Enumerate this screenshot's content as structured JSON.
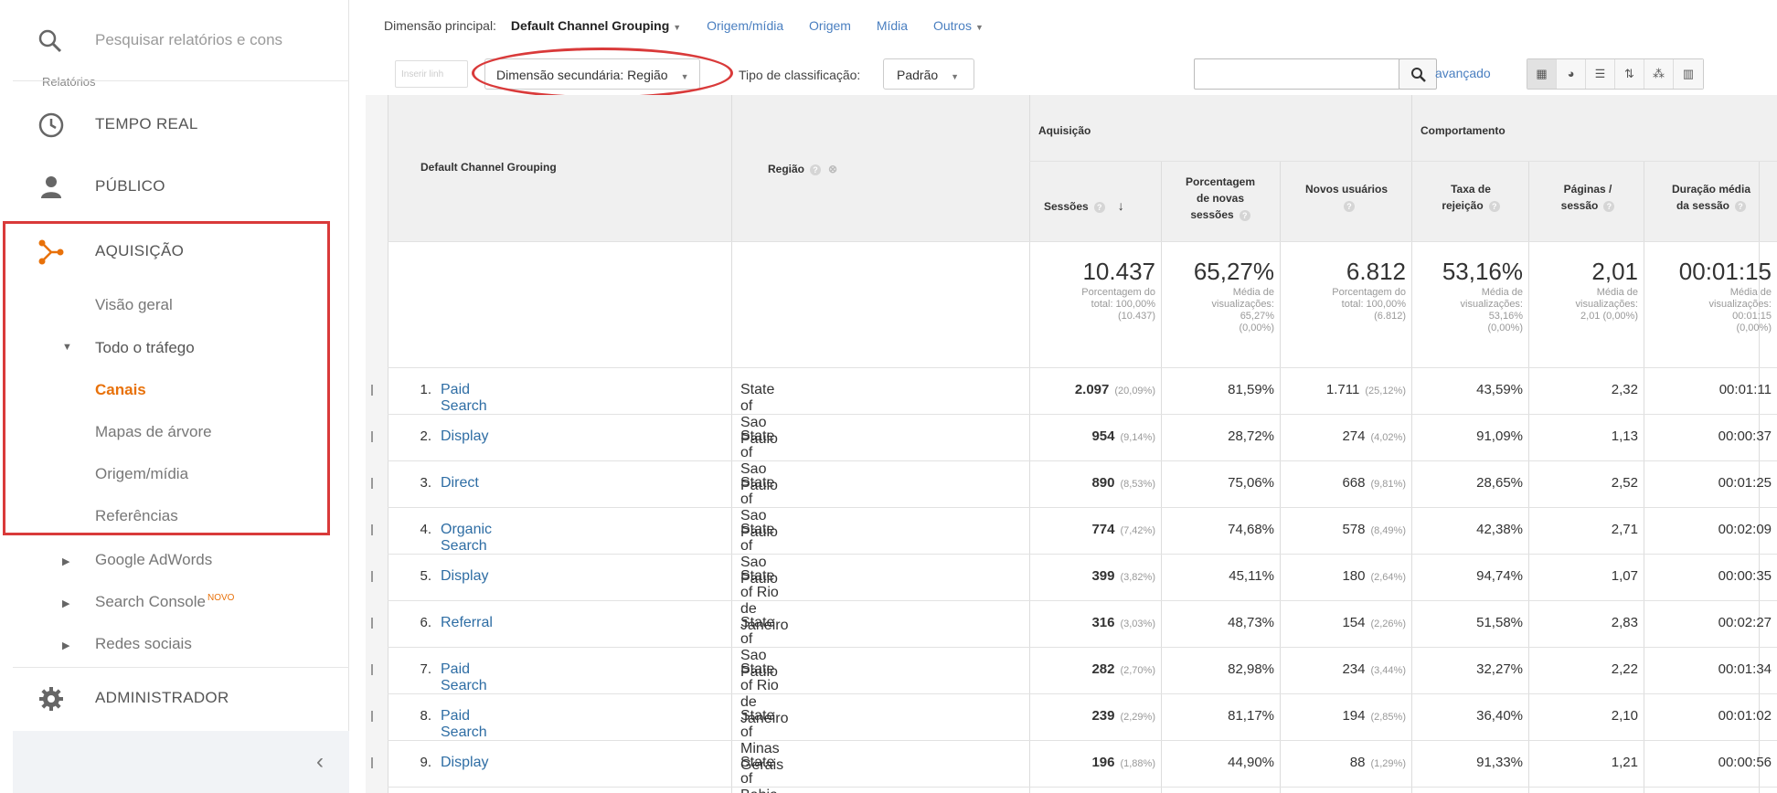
{
  "sidebar": {
    "search_placeholder": "Pesquisar relatórios e cons",
    "search_cut_label": "Relatórios",
    "realtime": "TEMPO REAL",
    "audience": "PÚBLICO",
    "acquisition": "AQUISIÇÃO",
    "acq_items": [
      "Visão geral",
      "Todo o tráfego",
      "Canais",
      "Mapas de árvore",
      "Origem/mídia",
      "Referências"
    ],
    "other_items": [
      "Google AdWords",
      "Search Console",
      "Redes sociais"
    ],
    "new_badge": "NOVO",
    "admin": "ADMINISTRADOR",
    "collapse_icon": "‹"
  },
  "toolbar": {
    "primary_dim_label": "Dimensão principal:",
    "primary_dim_value": "Default Channel Grouping",
    "links": [
      "Origem/mídia",
      "Origem",
      "Mídia",
      "Outros"
    ],
    "faded_button": "Inserir linh",
    "secondary_dim": "Dimensão secundária: Região",
    "sort_label": "Tipo de classificação:",
    "sort_value": "Padrão",
    "advanced": "avançado"
  },
  "table": {
    "col_channel": "Default Channel Grouping",
    "col_region": "Região",
    "group_acq": "Aquisição",
    "group_beh": "Comportamento",
    "col_sessions": "Sessões",
    "col_new_sessions": [
      "Porcentagem",
      "de novas",
      "sessões"
    ],
    "col_new_users": "Novos usuários",
    "col_bounce": [
      "Taxa de",
      "rejeição"
    ],
    "col_pages": [
      "Páginas /",
      "sessão"
    ],
    "col_duration": [
      "Duração média",
      "da sessão"
    ],
    "totals": {
      "sessions": "10.437",
      "sessions_sub": [
        "Porcentagem do",
        "total: 100,00%",
        "(10.437)"
      ],
      "new_sessions": "65,27%",
      "new_sessions_sub": [
        "Média de",
        "visualizações:",
        "65,27%",
        "(0,00%)"
      ],
      "new_users": "6.812",
      "new_users_sub": [
        "Porcentagem do",
        "total: 100,00%",
        "(6.812)"
      ],
      "bounce": "53,16%",
      "bounce_sub": [
        "Média de",
        "visualizações:",
        "53,16%",
        "(0,00%)"
      ],
      "pages": "2,01",
      "pages_sub": [
        "Média de",
        "visualizações:",
        "2,01 (0,00%)"
      ],
      "duration": "00:01:15",
      "duration_sub": [
        "Média de",
        "visualizações:",
        "00:01:15",
        "(0,00%)"
      ]
    },
    "rows": [
      {
        "n": "1.",
        "channel": "Paid Search",
        "region": "State of Sao Paulo",
        "sessions": "2.097",
        "sessions_pct": "(20,09%)",
        "new_sessions": "81,59%",
        "new_users": "1.711",
        "new_users_pct": "(25,12%)",
        "bounce": "43,59%",
        "pages": "2,32",
        "duration": "00:01:11"
      },
      {
        "n": "2.",
        "channel": "Display",
        "region": "State of Sao Paulo",
        "sessions": "954",
        "sessions_pct": "(9,14%)",
        "new_sessions": "28,72%",
        "new_users": "274",
        "new_users_pct": "(4,02%)",
        "bounce": "91,09%",
        "pages": "1,13",
        "duration": "00:00:37"
      },
      {
        "n": "3.",
        "channel": "Direct",
        "region": "State of Sao Paulo",
        "sessions": "890",
        "sessions_pct": "(8,53%)",
        "new_sessions": "75,06%",
        "new_users": "668",
        "new_users_pct": "(9,81%)",
        "bounce": "28,65%",
        "pages": "2,52",
        "duration": "00:01:25"
      },
      {
        "n": "4.",
        "channel": "Organic Search",
        "region": "State of Sao Paulo",
        "sessions": "774",
        "sessions_pct": "(7,42%)",
        "new_sessions": "74,68%",
        "new_users": "578",
        "new_users_pct": "(8,49%)",
        "bounce": "42,38%",
        "pages": "2,71",
        "duration": "00:02:09"
      },
      {
        "n": "5.",
        "channel": "Display",
        "region": "State of Rio de Janeiro",
        "sessions": "399",
        "sessions_pct": "(3,82%)",
        "new_sessions": "45,11%",
        "new_users": "180",
        "new_users_pct": "(2,64%)",
        "bounce": "94,74%",
        "pages": "1,07",
        "duration": "00:00:35"
      },
      {
        "n": "6.",
        "channel": "Referral",
        "region": "State of Sao Paulo",
        "sessions": "316",
        "sessions_pct": "(3,03%)",
        "new_sessions": "48,73%",
        "new_users": "154",
        "new_users_pct": "(2,26%)",
        "bounce": "51,58%",
        "pages": "2,83",
        "duration": "00:02:27"
      },
      {
        "n": "7.",
        "channel": "Paid Search",
        "region": "State of Rio de Janeiro",
        "sessions": "282",
        "sessions_pct": "(2,70%)",
        "new_sessions": "82,98%",
        "new_users": "234",
        "new_users_pct": "(3,44%)",
        "bounce": "32,27%",
        "pages": "2,22",
        "duration": "00:01:34"
      },
      {
        "n": "8.",
        "channel": "Paid Search",
        "region": "State of Minas Gerais",
        "sessions": "239",
        "sessions_pct": "(2,29%)",
        "new_sessions": "81,17%",
        "new_users": "194",
        "new_users_pct": "(2,85%)",
        "bounce": "36,40%",
        "pages": "2,10",
        "duration": "00:01:02"
      },
      {
        "n": "9.",
        "channel": "Display",
        "region": "State of Bahia",
        "sessions": "196",
        "sessions_pct": "(1,88%)",
        "new_sessions": "44,90%",
        "new_users": "88",
        "new_users_pct": "(1,29%)",
        "bounce": "91,33%",
        "pages": "1,21",
        "duration": "00:00:56"
      }
    ]
  },
  "colors": {
    "accent": "#e8710a",
    "link": "#2e6da4",
    "highlight_red": "#d93a3a"
  }
}
